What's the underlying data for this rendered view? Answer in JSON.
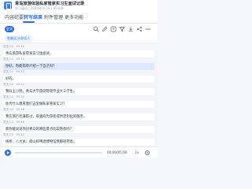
{
  "header": {
    "title": "青岛旅游体验私家管家实习生面试记录",
    "meta": "实习面试 | 2024年-6-19 | 45分钟"
  },
  "tabs": [
    {
      "label": "内容纪要",
      "active": false
    },
    {
      "label": "转写结果",
      "active": true
    },
    {
      "label": "附件管理",
      "active": false
    },
    {
      "label": "更多功能",
      "active": false
    }
  ],
  "toolbar": {
    "chip_label": "全文",
    "icons": [
      "search-icon",
      "edit-icon",
      "translate-icon",
      "filter-icon",
      "download-icon",
      "share-icon",
      "more-icon"
    ]
  },
  "actionbar": {
    "button_label": "智能区分说话人"
  },
  "transcript": [
    {
      "speaker": "发言人1 · 00:10",
      "text": "青岛旅游私家管家实习生面试。",
      "highlight": false
    },
    {
      "speaker": "发言人1 · 00:14",
      "text": "你好，你能简单介绍一下自己吗？",
      "highlight": true
    },
    {
      "speaker": "发言人2 · 00:20",
      "text": "好的。",
      "highlight": false
    },
    {
      "speaker": "发言人2 · 00:24",
      "text": "我叫王小明，青岛大学旅游管理专业大三学生。",
      "highlight": false
    },
    {
      "speaker": "发言人1 · 00:32",
      "text": "你为什么想来我们这里做私家管家实习？",
      "highlight": false
    },
    {
      "speaker": "发言人2 · 00:38",
      "text": "我在旅行社兼职过，很喜欢为游客提供定制化的服务。",
      "highlight": false
    },
    {
      "speaker": "发言人1 · 00:46",
      "text": "那你能说说你对青岛的哪些景点比较熟悉吗？",
      "highlight": false
    },
    {
      "speaker": "发言人2 · 00:52",
      "text": "栈桥、八大关、崂山和啤酒博物馆我都很熟悉。",
      "highlight": false
    }
  ],
  "player": {
    "current_time": "00:00",
    "total_time": "45:00",
    "time_display": "00:00/45:00",
    "progress_fraction": 0.0,
    "speed_label": "1x"
  },
  "colors": {
    "accent": "#2f6fe0",
    "highlight_bubble": "#dbe8ff",
    "background": "#f3f5f9"
  }
}
